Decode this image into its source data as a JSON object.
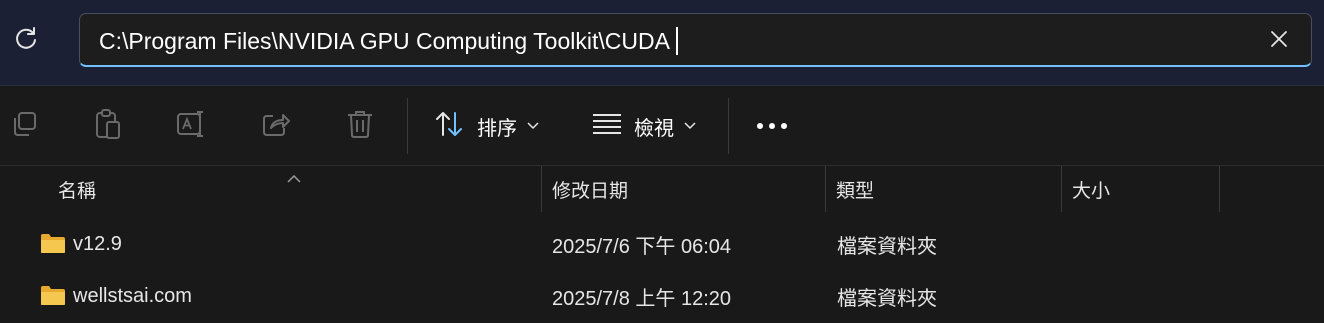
{
  "address_bar": {
    "path": "C:\\Program Files\\NVIDIA GPU Computing Toolkit\\CUDA"
  },
  "toolbar": {
    "sort_label": "排序",
    "view_label": "檢視"
  },
  "columns": {
    "name": "名稱",
    "modified": "修改日期",
    "type": "類型",
    "size": "大小"
  },
  "rows": [
    {
      "name": "v12.9",
      "modified": "2025/7/6 下午 06:04",
      "type": "檔案資料夾",
      "size": ""
    },
    {
      "name": "wellstsai.com",
      "modified": "2025/7/8 上午 12:20",
      "type": "檔案資料夾",
      "size": ""
    }
  ],
  "icons": {
    "refresh": "refresh-icon",
    "clear": "close-icon",
    "copy": "copy-icon",
    "paste": "paste-icon",
    "rename": "rename-icon",
    "share": "share-icon",
    "delete": "trash-icon",
    "sort": "sort-icon",
    "view": "view-icon",
    "more": "more-icon",
    "folder": "folder-icon"
  },
  "colors": {
    "accent": "#6fc1ff",
    "folder": "#f5c74e",
    "background": "#191919"
  }
}
